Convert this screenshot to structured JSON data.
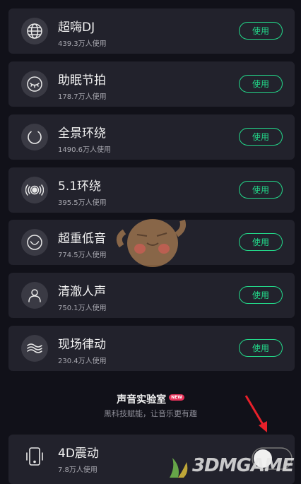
{
  "items": [
    {
      "title": "超嗨DJ",
      "users": "439.3万人使用",
      "button": "使用",
      "icon": "globe-icon"
    },
    {
      "title": "助眠节拍",
      "users": "178.7万人使用",
      "button": "使用",
      "icon": "sleep-eye-icon"
    },
    {
      "title": "全景环绕",
      "users": "1490.6万人使用",
      "button": "使用",
      "icon": "surround-ring-icon"
    },
    {
      "title": "5.1环绕",
      "users": "395.5万人使用",
      "button": "使用",
      "icon": "speaker-wave-icon"
    },
    {
      "title": "超重低音",
      "users": "774.5万人使用",
      "button": "使用",
      "icon": "bass-smile-icon"
    },
    {
      "title": "清澈人声",
      "users": "750.1万人使用",
      "button": "使用",
      "icon": "person-voice-icon"
    },
    {
      "title": "现场律动",
      "users": "230.4万人使用",
      "button": "使用",
      "icon": "wave-lines-icon"
    }
  ],
  "lab": {
    "title": "声音实验室",
    "badge": "NEW",
    "subtitle": "黑科技赋能，让音乐更有趣"
  },
  "vibration": {
    "title": "4D震动",
    "users": "7.8万人使用",
    "icon": "phone-vibrate-icon"
  },
  "watermark": {
    "text": "3DMGAME"
  },
  "colors": {
    "accent": "#23d98a",
    "card": "#22222c",
    "background": "#111119"
  }
}
